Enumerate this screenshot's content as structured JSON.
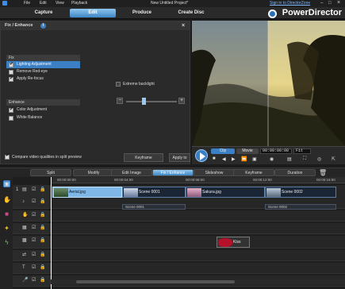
{
  "window": {
    "title": "New Untitled Project*"
  },
  "menu": [
    "File",
    "Edit",
    "View",
    "Playback"
  ],
  "topbar": {
    "signin": "Sign in to DirectorZone"
  },
  "brand": "PowerDirector",
  "nav": {
    "tabs": [
      "Capture",
      "Edit",
      "Produce",
      "Create Disc"
    ],
    "active": "Edit"
  },
  "fix_panel": {
    "title": "Fix / Enhance",
    "fix_group": "Fix",
    "fix_options": [
      {
        "label": "Lighting Adjustment",
        "checked": true,
        "selected": true
      },
      {
        "label": "Remove Red-eye",
        "checked": false,
        "selected": false
      },
      {
        "label": "Apply Re-focus",
        "checked": true,
        "selected": false
      }
    ],
    "extreme_backlight": "Extreme backlight",
    "enhance_group": "Enhance",
    "enhance_options": [
      {
        "label": "Color Adjustment",
        "checked": true
      },
      {
        "label": "White Balance",
        "checked": false
      }
    ],
    "compare_label": "Compare video qualities in split preview",
    "keyframe_btn": "Keyframe",
    "apply_btn": "Apply to"
  },
  "preview": {
    "mode_clip": "Clip",
    "mode_movie": "Movie",
    "timecode": "00:00:00:00",
    "fit": "Fit"
  },
  "edit_toolbar": [
    "Split",
    "Modify",
    "Edit Image",
    "Fix / Enhance",
    "Slideshow",
    "Keyframe",
    "Duration"
  ],
  "edit_toolbar_active": "Fix / Enhance",
  "timeline": {
    "ruler": [
      "00:00:00:00",
      "00:00:04:00",
      "00:00:08:00",
      "00:00:12:00",
      "00:00:16:00"
    ],
    "video_clips": [
      "Aerial.jpg",
      "Scene 0001",
      "Sakura.jpg",
      "Scene 0002"
    ],
    "audio_clips": [
      "Scene 0001",
      "Scene 0002"
    ],
    "effect_clip": "Kiss"
  }
}
